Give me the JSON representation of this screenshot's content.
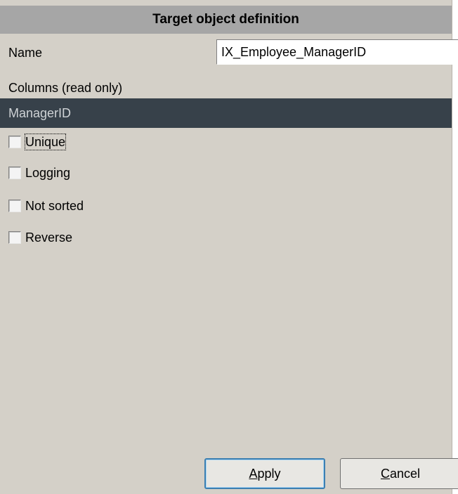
{
  "header": {
    "title": "Target object definition"
  },
  "name": {
    "label": "Name",
    "value": "IX_Employee_ManagerID"
  },
  "columns": {
    "label": "Columns (read only)",
    "items": [
      "ManagerID"
    ]
  },
  "options": [
    {
      "label": "Unique",
      "checked": false
    },
    {
      "label": "Logging",
      "checked": false
    },
    {
      "label": "Not sorted",
      "checked": false
    },
    {
      "label": "Reverse",
      "checked": false
    }
  ],
  "buttons": {
    "apply_accel": "A",
    "apply_rest": "pply",
    "cancel_accel": "C",
    "cancel_rest": "ancel"
  }
}
